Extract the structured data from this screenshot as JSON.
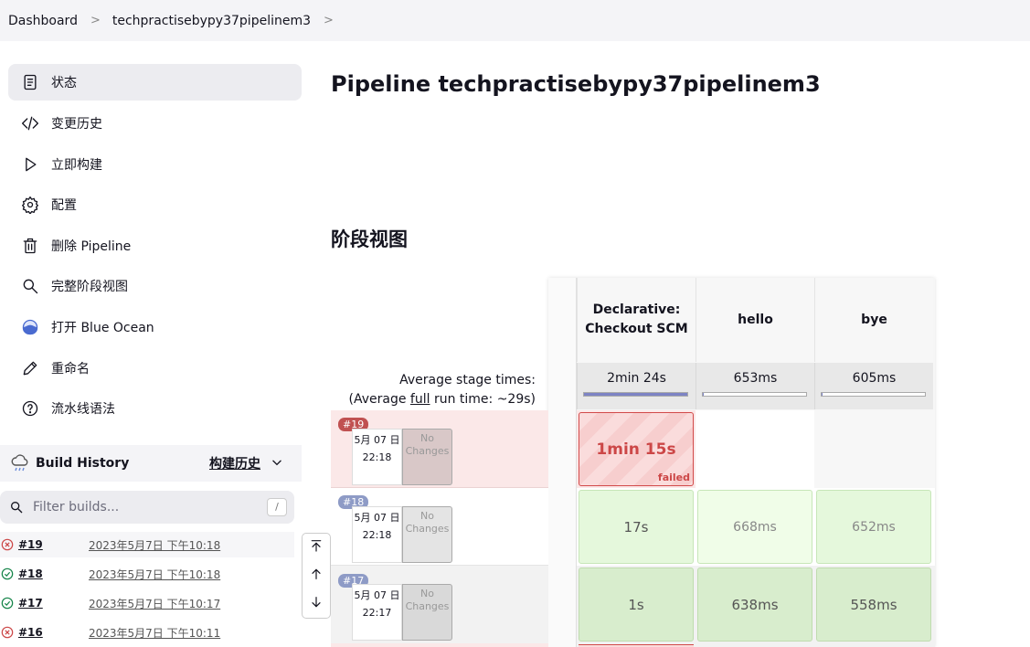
{
  "breadcrumb": {
    "root": "Dashboard",
    "job": "techpractisebypy37pipelinem3"
  },
  "sidebar": {
    "items": [
      {
        "label": "状态",
        "icon": "document-icon"
      },
      {
        "label": "变更历史",
        "icon": "code-icon"
      },
      {
        "label": "立即构建",
        "icon": "play-icon"
      },
      {
        "label": "配置",
        "icon": "gear-icon"
      },
      {
        "label": "删除 Pipeline",
        "icon": "trash-icon"
      },
      {
        "label": "完整阶段视图",
        "icon": "search-icon"
      },
      {
        "label": "打开 Blue Ocean",
        "icon": "blue-ocean-icon"
      },
      {
        "label": "重命名",
        "icon": "pencil-icon"
      },
      {
        "label": "流水线语法",
        "icon": "help-icon"
      }
    ]
  },
  "build_history": {
    "title": "Build History",
    "trend_label": "构建历史",
    "filter_placeholder": "Filter builds...",
    "filter_shortcut": "/",
    "builds": [
      {
        "num": "#19",
        "date": "2023年5月7日 下午10:18",
        "status": "failed"
      },
      {
        "num": "#18",
        "date": "2023年5月7日 下午10:18",
        "status": "success"
      },
      {
        "num": "#17",
        "date": "2023年5月7日 下午10:17",
        "status": "success"
      },
      {
        "num": "#16",
        "date": "2023年5月7日 下午10:11",
        "status": "failed"
      }
    ]
  },
  "main": {
    "title": "Pipeline techpractisebypy37pipelinem3",
    "stage_view_title": "阶段视图",
    "avg_label_line1": "Average stage times:",
    "avg_label_pre": "(Average ",
    "avg_label_full": "full",
    "avg_label_post": " run time: ~29s)",
    "stages": [
      {
        "name": "Declarative: Checkout SCM",
        "avg": "2min 24s",
        "avg_fraction": 1.0
      },
      {
        "name": "hello",
        "avg": "653ms",
        "avg_fraction": 0.01
      },
      {
        "name": "bye",
        "avg": "605ms",
        "avg_fraction": 0.01
      }
    ],
    "runs": [
      {
        "badge": "#19",
        "date": "5月 07 日",
        "time": "22:18",
        "changes": "No Changes",
        "cells": [
          "1min 15s",
          "",
          ""
        ],
        "cell_status": "failed",
        "failed_label": "failed"
      },
      {
        "badge": "#18",
        "date": "5月 07 日",
        "time": "22:18",
        "changes": "No Changes",
        "cells": [
          "17s",
          "668ms",
          "652ms"
        ],
        "cell_status": "success"
      },
      {
        "badge": "#17",
        "date": "5月 07 日",
        "time": "22:17",
        "changes": "No Changes",
        "cells": [
          "1s",
          "638ms",
          "558ms"
        ],
        "cell_status": "success"
      }
    ]
  },
  "colors": {
    "failed": "#cc4747",
    "success": "#138347",
    "badge_fail": "#c05151",
    "badge_ok": "#8e9bc6"
  }
}
